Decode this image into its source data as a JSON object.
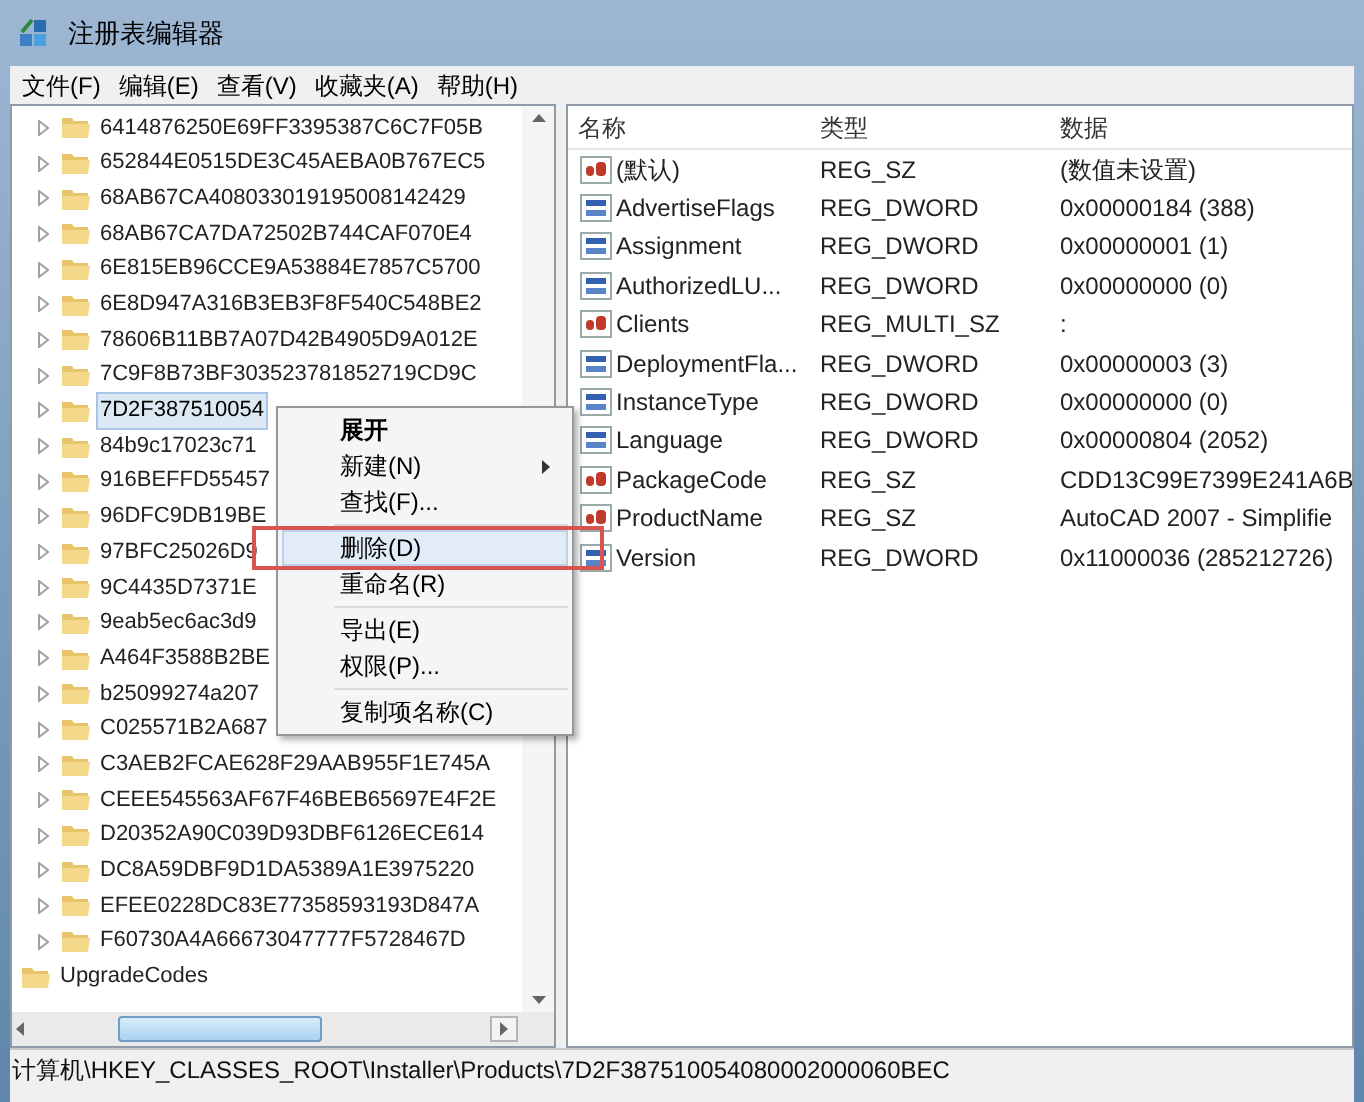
{
  "window": {
    "title": "注册表编辑器"
  },
  "menu_bar": [
    "文件(F)",
    "编辑(E)",
    "查看(V)",
    "收藏夹(A)",
    "帮助(H)"
  ],
  "tree": {
    "subkeys": [
      {
        "label": "6414876250E69FF3395387C6C7F05B",
        "selected": false
      },
      {
        "label": "652844E0515DE3C45AEBA0B767EC5",
        "selected": false
      },
      {
        "label": "68AB67CA408033019195008142429",
        "selected": false
      },
      {
        "label": "68AB67CA7DA72502B744CAF070E4",
        "selected": false
      },
      {
        "label": "6E815EB96CCE9A53884E7857C5700",
        "selected": false
      },
      {
        "label": "6E8D947A316B3EB3F8F540C548BE2",
        "selected": false
      },
      {
        "label": "78606B11BB7A07D42B4905D9A012E",
        "selected": false
      },
      {
        "label": "7C9F8B73BF303523781852719CD9C",
        "selected": false
      },
      {
        "label": "7D2F387510054",
        "selected": true
      },
      {
        "label": "84b9c17023c71",
        "selected": false
      },
      {
        "label": "916BEFFD55457",
        "selected": false
      },
      {
        "label": "96DFC9DB19BE",
        "selected": false
      },
      {
        "label": "97BFC25026D9",
        "selected": false
      },
      {
        "label": "9C4435D7371E",
        "selected": false
      },
      {
        "label": "9eab5ec6ac3d9",
        "selected": false
      },
      {
        "label": "A464F3588B2BE",
        "selected": false
      },
      {
        "label": "b25099274a207",
        "selected": false
      },
      {
        "label": "C025571B2A687",
        "selected": false
      },
      {
        "label": "C3AEB2FCAE628F29AAB955F1E745A",
        "selected": false
      },
      {
        "label": "CEEE545563AF67F46BEB65697E4F2E",
        "selected": false
      },
      {
        "label": "D20352A90C039D93DBF6126ECE614",
        "selected": false
      },
      {
        "label": "DC8A59DBF9D1DA5389A1E3975220",
        "selected": false
      },
      {
        "label": "EFEE0228DC83E77358593193D847A",
        "selected": false
      },
      {
        "label": "F60730A4A66673047777F5728467D",
        "selected": false
      }
    ],
    "items": [
      {
        "label": "UpgradeCodes",
        "selected": false
      }
    ]
  },
  "values": {
    "columns": [
      "名称",
      "类型",
      "数据"
    ],
    "rows": [
      {
        "kind": "string",
        "name": "(默认)",
        "type": "REG_SZ",
        "data": "(数值未设置)"
      },
      {
        "kind": "binary",
        "name": "AdvertiseFlags",
        "type": "REG_DWORD",
        "data": "0x00000184 (388)"
      },
      {
        "kind": "binary",
        "name": "Assignment",
        "type": "REG_DWORD",
        "data": "0x00000001 (1)"
      },
      {
        "kind": "binary",
        "name": "AuthorizedLU...",
        "type": "REG_DWORD",
        "data": "0x00000000 (0)"
      },
      {
        "kind": "string",
        "name": "Clients",
        "type": "REG_MULTI_SZ",
        "data": ":"
      },
      {
        "kind": "binary",
        "name": "DeploymentFla...",
        "type": "REG_DWORD",
        "data": "0x00000003 (3)"
      },
      {
        "kind": "binary",
        "name": "InstanceType",
        "type": "REG_DWORD",
        "data": "0x00000000 (0)"
      },
      {
        "kind": "binary",
        "name": "Language",
        "type": "REG_DWORD",
        "data": "0x00000804 (2052)"
      },
      {
        "kind": "string",
        "name": "PackageCode",
        "type": "REG_SZ",
        "data": "CDD13C99E7399E241A6B"
      },
      {
        "kind": "string",
        "name": "ProductName",
        "type": "REG_SZ",
        "data": "AutoCAD 2007 - Simplifie"
      },
      {
        "kind": "binary",
        "name": "Version",
        "type": "REG_DWORD",
        "data": "0x11000036 (285212726)"
      }
    ]
  },
  "context_menu": {
    "items": [
      {
        "kind": "item",
        "label": "展开",
        "bold": true,
        "submenu": false,
        "highlighted": false,
        "outlined": false
      },
      {
        "kind": "item",
        "label": "新建(N)",
        "bold": false,
        "submenu": true,
        "highlighted": false,
        "outlined": false
      },
      {
        "kind": "item",
        "label": "查找(F)...",
        "bold": false,
        "submenu": false,
        "highlighted": false,
        "outlined": false
      },
      {
        "kind": "separator"
      },
      {
        "kind": "item",
        "label": "删除(D)",
        "bold": false,
        "submenu": false,
        "highlighted": true,
        "outlined": true
      },
      {
        "kind": "item",
        "label": "重命名(R)",
        "bold": false,
        "submenu": false,
        "highlighted": false,
        "outlined": false
      },
      {
        "kind": "separator"
      },
      {
        "kind": "item",
        "label": "导出(E)",
        "bold": false,
        "submenu": false,
        "highlighted": false,
        "outlined": false
      },
      {
        "kind": "item",
        "label": "权限(P)...",
        "bold": false,
        "submenu": false,
        "highlighted": false,
        "outlined": false
      },
      {
        "kind": "separator"
      },
      {
        "kind": "item",
        "label": "复制项名称(C)",
        "bold": false,
        "submenu": false,
        "highlighted": false,
        "outlined": false
      }
    ]
  },
  "status_bar": "计算机\\HKEY_CLASSES_ROOT\\Installer\\Products\\7D2F387510054080002000060BEC"
}
